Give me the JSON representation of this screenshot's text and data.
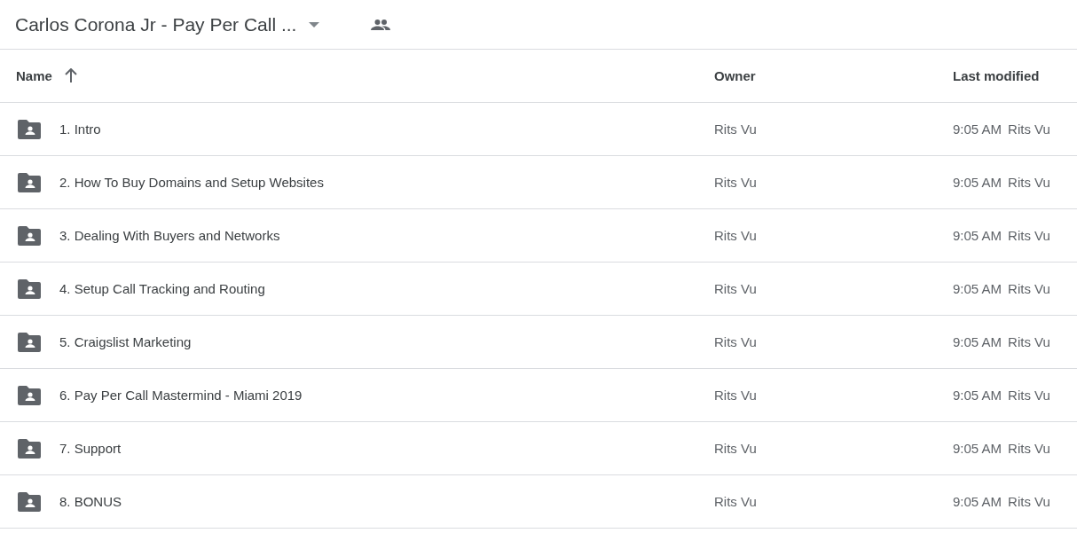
{
  "header": {
    "title": "Carlos Corona Jr - Pay Per Call ..."
  },
  "table": {
    "columns": [
      {
        "label": "Name",
        "sorted": true
      },
      {
        "label": "Owner",
        "sorted": false
      },
      {
        "label": "Last modified",
        "sorted": false
      }
    ],
    "rows": [
      {
        "name": "1. Intro",
        "owner": "Rits Vu",
        "time": "9:05 AM",
        "modifier": "Rits Vu"
      },
      {
        "name": "2. How To Buy Domains and Setup Websites",
        "owner": "Rits Vu",
        "time": "9:05 AM",
        "modifier": "Rits Vu"
      },
      {
        "name": "3. Dealing With Buyers and Networks",
        "owner": "Rits Vu",
        "time": "9:05 AM",
        "modifier": "Rits Vu"
      },
      {
        "name": "4. Setup Call Tracking and Routing",
        "owner": "Rits Vu",
        "time": "9:05 AM",
        "modifier": "Rits Vu"
      },
      {
        "name": "5. Craigslist Marketing",
        "owner": "Rits Vu",
        "time": "9:05 AM",
        "modifier": "Rits Vu"
      },
      {
        "name": "6. Pay Per Call Mastermind - Miami 2019",
        "owner": "Rits Vu",
        "time": "9:05 AM",
        "modifier": "Rits Vu"
      },
      {
        "name": "7. Support",
        "owner": "Rits Vu",
        "time": "9:05 AM",
        "modifier": "Rits Vu"
      },
      {
        "name": "8. BONUS",
        "owner": "Rits Vu",
        "time": "9:05 AM",
        "modifier": "Rits Vu"
      }
    ]
  }
}
